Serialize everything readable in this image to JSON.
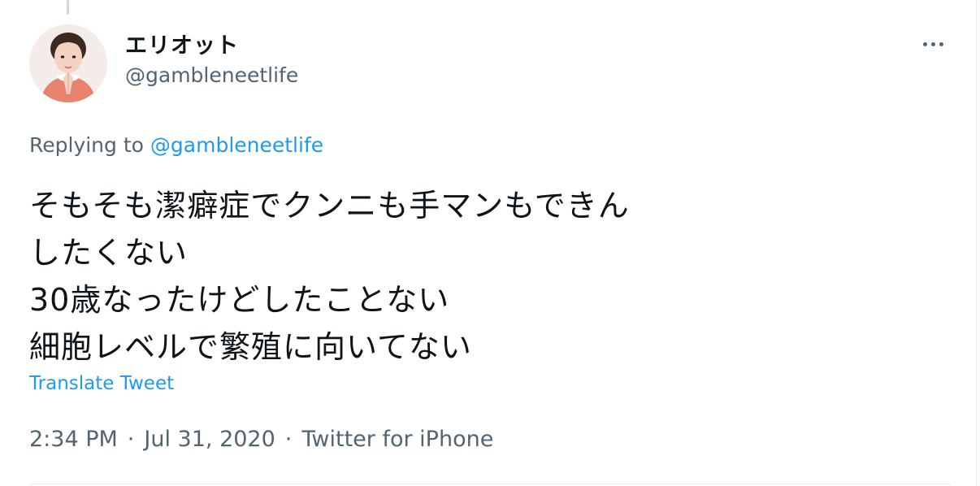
{
  "tweet": {
    "author_name": "エリオット",
    "author_handle": "@gambleneetlife",
    "replying_prefix": "Replying to",
    "replying_to": "@gambleneetlife",
    "text_lines": [
      "そもそも潔癖症でクンニも手マンもできん",
      "したくない",
      "30歳なったけどしたことない",
      "細胞レベルで繁殖に向いてない"
    ],
    "translate_label": "Translate Tweet",
    "time": "2:34 PM",
    "date": "Jul 31, 2020",
    "source": "Twitter for iPhone",
    "separator": "·"
  },
  "icons": {
    "more": "more-horizontal-icon",
    "avatar": "avatar-image"
  },
  "colors": {
    "text": "#0f1419",
    "secondary": "#536471",
    "link": "#1d9bf0",
    "border": "#e6ecf0"
  }
}
